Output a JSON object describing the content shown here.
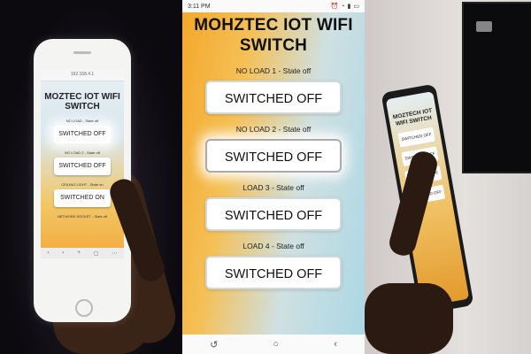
{
  "left_photo": {
    "title": "MOZTEC IOT WIFI SWITCH",
    "url": "192.168.4.1",
    "items": [
      {
        "label": "NO LOAD - State off",
        "button": "SWITCHED OFF",
        "glow": true
      },
      {
        "label": "NO LOAD 2 - State off",
        "button": "SWITCHED OFF",
        "glow": false
      },
      {
        "label": "CEILING LIGHT - State on",
        "button": "SWITCHED ON",
        "glow": false
      },
      {
        "label": "NETWORK SOCKET - State off",
        "button": "",
        "glow": false
      }
    ]
  },
  "app": {
    "status_time": "3:11 PM",
    "status_icons": [
      "alarm-icon",
      "wifi-icon",
      "signal-icon",
      "battery-icon"
    ],
    "title": "MOHZTEC IOT WIFI SWITCH",
    "loads": [
      {
        "label": "NO LOAD 1 - State off",
        "button": "SWITCHED OFF",
        "highlighted": false
      },
      {
        "label": "NO LOAD 2 - State off",
        "button": "SWITCHED OFF",
        "highlighted": true
      },
      {
        "label": "LOAD 3 - State off",
        "button": "SWITCHED OFF",
        "highlighted": false
      },
      {
        "label": "LOAD 4 - State off",
        "button": "SWITCHED OFF",
        "highlighted": false
      }
    ],
    "nav": [
      "back-icon",
      "home-icon",
      "recents-icon"
    ]
  },
  "right_photo": {
    "title": "MOZTECH IOT WIFI SWITCH",
    "buttons": [
      "SWITCHED OFF",
      "SWITCHED OFF",
      "SWITCHED OFF",
      "SWITCHED OFF"
    ]
  },
  "colors": {
    "accent_orange": "#f3a72a",
    "accent_blue": "#aad7e4",
    "button_bg": "#ffffff"
  }
}
